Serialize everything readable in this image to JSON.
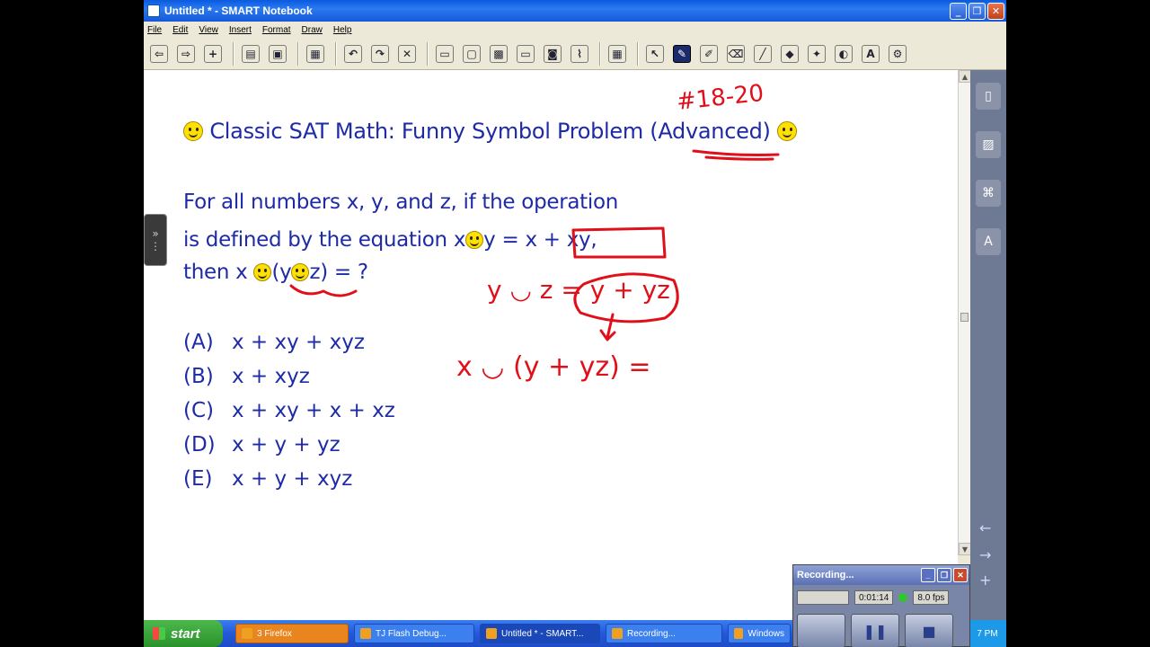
{
  "window": {
    "title": "Untitled * - SMART Notebook"
  },
  "menu": [
    "File",
    "Edit",
    "View",
    "Insert",
    "Format",
    "Draw",
    "Help"
  ],
  "toolbar": {
    "buttons": [
      {
        "name": "back-icon",
        "glyph": "⇦"
      },
      {
        "name": "forward-icon",
        "glyph": "⇨"
      },
      {
        "name": "add-page-icon",
        "glyph": "+"
      },
      {
        "sep": true
      },
      {
        "name": "open-icon",
        "glyph": "▤"
      },
      {
        "name": "save-icon",
        "glyph": "▣"
      },
      {
        "sep": true
      },
      {
        "name": "paste-icon",
        "glyph": "▦"
      },
      {
        "sep": true
      },
      {
        "name": "undo-icon",
        "glyph": "↶"
      },
      {
        "name": "redo-icon",
        "glyph": "↷"
      },
      {
        "name": "delete-icon",
        "glyph": "✕"
      },
      {
        "sep": true
      },
      {
        "name": "screen-shade-icon",
        "glyph": "▭"
      },
      {
        "name": "full-screen-icon",
        "glyph": "▢"
      },
      {
        "name": "table-grid-icon",
        "glyph": "▩"
      },
      {
        "name": "monitor-icon",
        "glyph": "▭"
      },
      {
        "name": "capture-icon",
        "glyph": "◙"
      },
      {
        "name": "document-camera-icon",
        "glyph": "⌇"
      },
      {
        "sep": true
      },
      {
        "name": "table-icon",
        "glyph": "▦"
      },
      {
        "sep": true
      },
      {
        "name": "select-icon",
        "glyph": "↖"
      },
      {
        "name": "pen-icon",
        "glyph": "✎",
        "active": true
      },
      {
        "name": "creative-pen-icon",
        "glyph": "✐"
      },
      {
        "name": "eraser-icon",
        "glyph": "⌫"
      },
      {
        "name": "line-icon",
        "glyph": "╱"
      },
      {
        "name": "shapes-icon",
        "glyph": "◆"
      },
      {
        "name": "magic-pen-icon",
        "glyph": "✦"
      },
      {
        "name": "fill-icon",
        "glyph": "◐"
      },
      {
        "name": "text-icon",
        "glyph": "A"
      },
      {
        "name": "properties-icon",
        "glyph": "⚙"
      }
    ]
  },
  "slide": {
    "title_before": "Classic SAT Math:  Funny Symbol Problem (",
    "title_underlined": "Advanced",
    "title_after": ")",
    "problem_line1": "For all numbers x, y, and z, if the operation",
    "problem_line2_a": "is defined by the equation  x",
    "problem_line2_b": "y = x + xy,",
    "problem_line3_a": "then x ",
    "problem_line3_b": "(y",
    "problem_line3_c": "z)  =  ?",
    "choices": [
      {
        "label": "(A)",
        "text": "x + xy + xyz"
      },
      {
        "label": "(B)",
        "text": "x + xyz"
      },
      {
        "label": "(C)",
        "text": "x + xy + x + xz"
      },
      {
        "label": "(D)",
        "text": "x + y + yz"
      },
      {
        "label": "(E)",
        "text": "x + y + xyz"
      }
    ],
    "handwriting": {
      "tag": "#18-20",
      "line1": "y ◡ z = y + yz",
      "line2": "x ◡ (y + yz) ="
    }
  },
  "recorder": {
    "title": "Recording...",
    "time": "0:01:14",
    "fps": "8.0 fps",
    "pause_glyph": "❚❚",
    "stop_glyph": "■"
  },
  "taskbar": {
    "start": "start",
    "tasks": [
      {
        "label": "3 Firefox",
        "kind": "firefox"
      },
      {
        "label": "TJ Flash Debug...",
        "kind": "normal"
      },
      {
        "label": "Untitled * - SMART...",
        "kind": "active"
      },
      {
        "label": "Recording...",
        "kind": "normal"
      },
      {
        "label": "Windows",
        "kind": "normal"
      }
    ],
    "clock": "7 PM"
  },
  "colors": {
    "text_blue": "#1e2aa6",
    "ink_red": "#e0101a"
  }
}
